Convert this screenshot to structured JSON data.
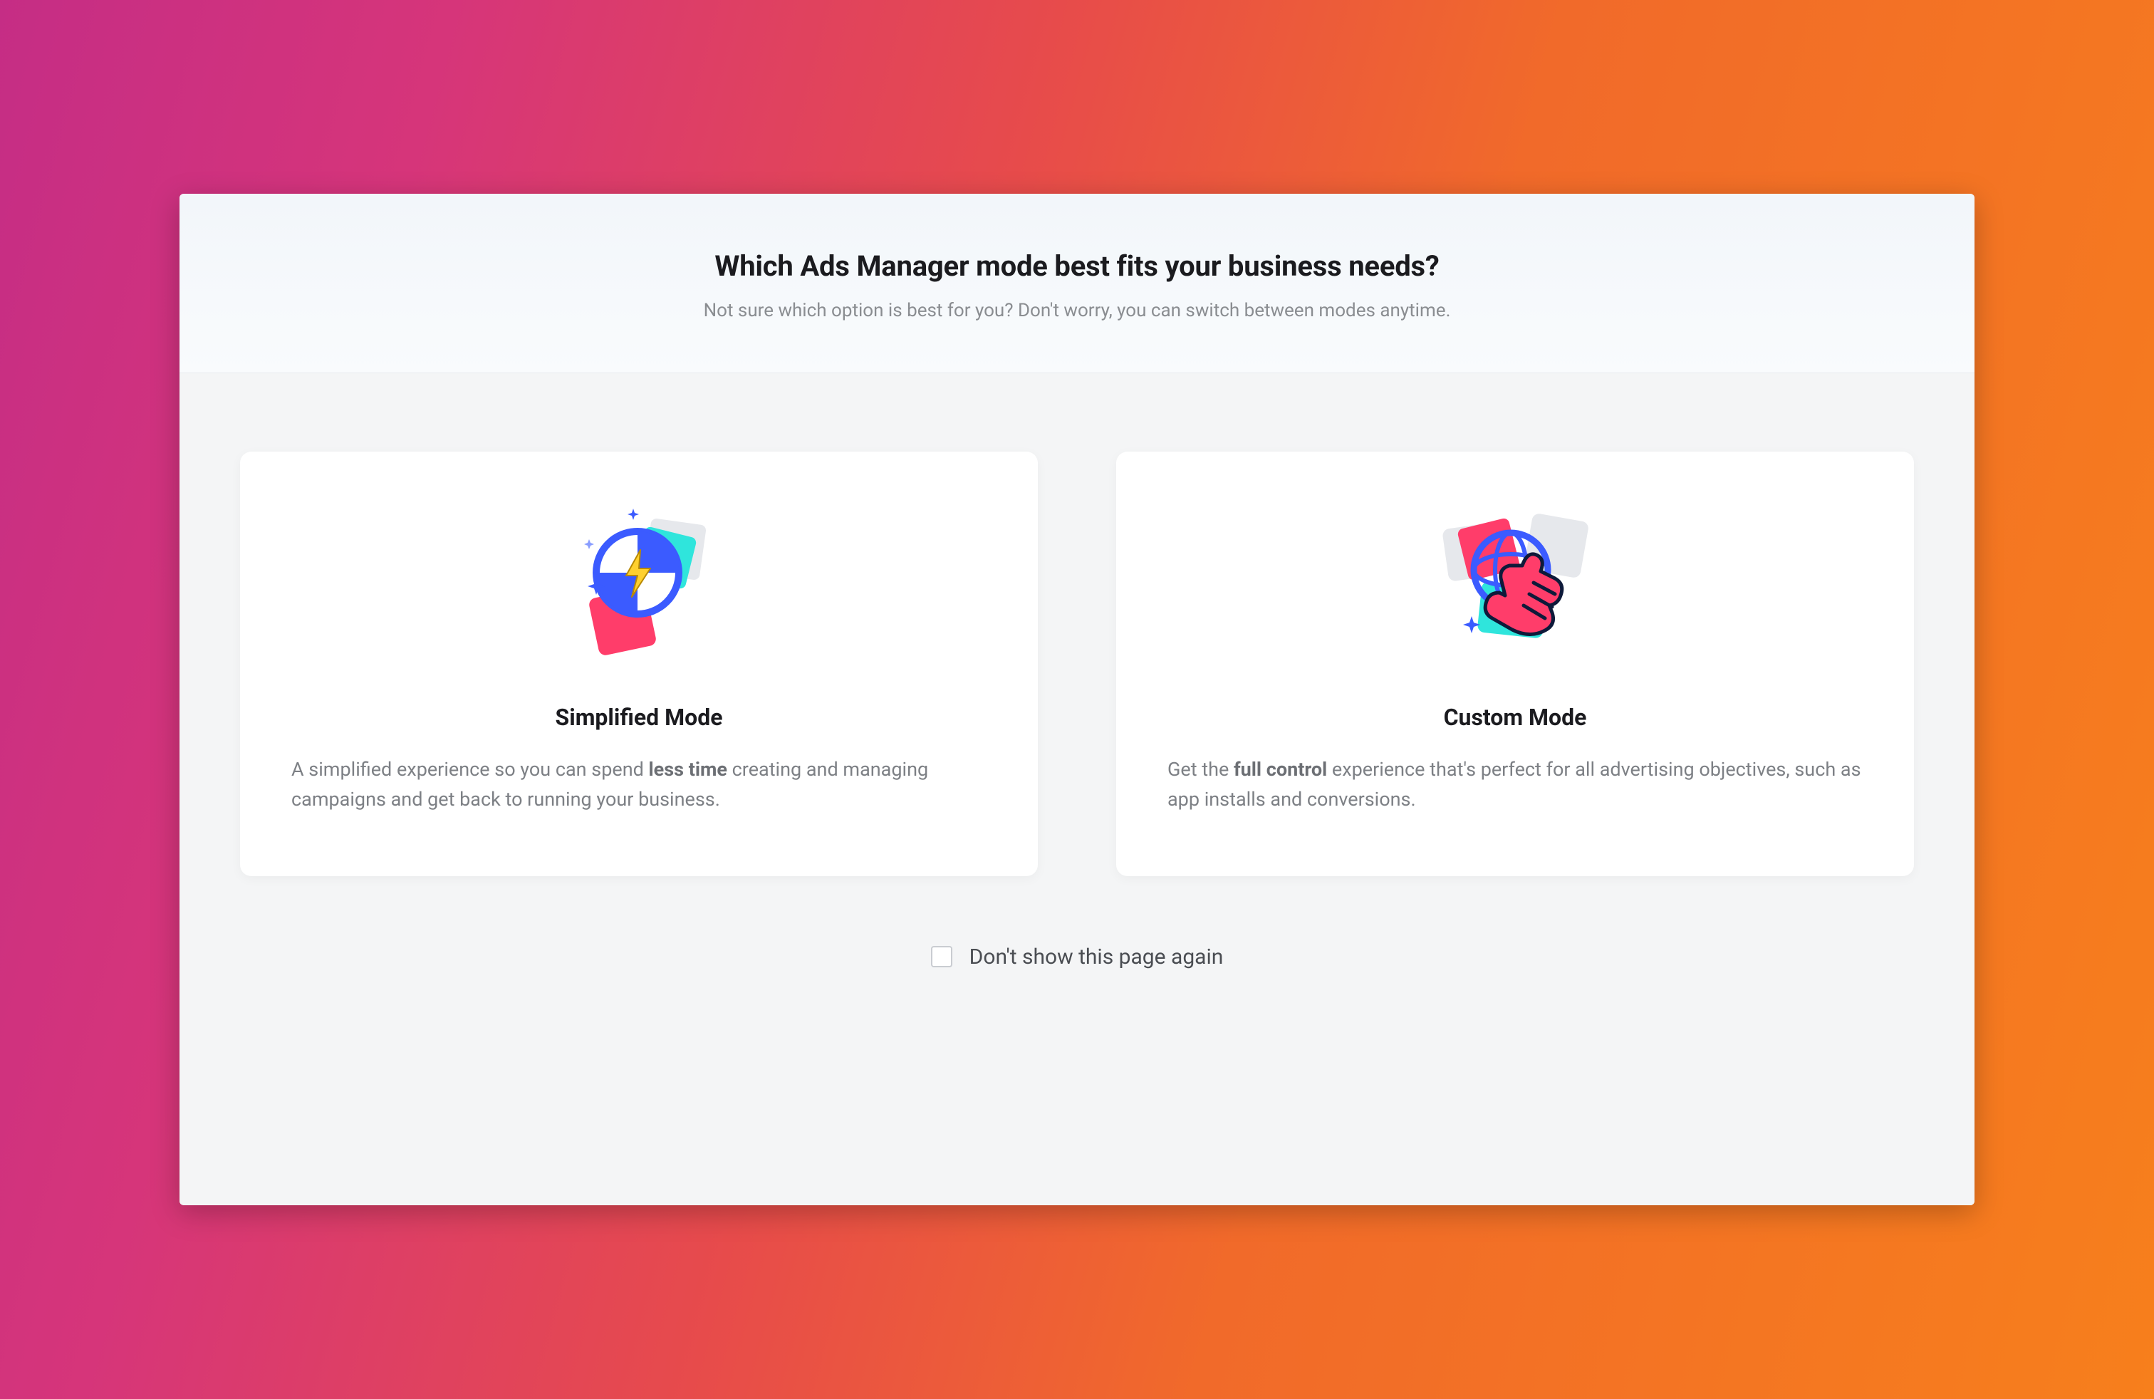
{
  "header": {
    "title": "Which Ads Manager mode best fits your business needs?",
    "subtitle": "Not sure which option is best for you? Don't worry, you can switch between modes anytime."
  },
  "cards": {
    "simplified": {
      "title": "Simplified Mode",
      "desc_before": "A simplified experience so you can spend ",
      "desc_bold": "less time",
      "desc_after": " creating and managing campaigns and get back to running your business."
    },
    "custom": {
      "title": "Custom Mode",
      "desc_before": "Get the ",
      "desc_bold": "full control",
      "desc_after": " experience that's perfect for all advertising objectives, such as app installs and conversions."
    }
  },
  "dont_show_label": "Don't show this page again",
  "colors": {
    "accent_blue": "#3b5bff",
    "accent_pink": "#ff3d6a",
    "accent_teal": "#2fe5dc",
    "accent_yellow": "#ffd02e"
  }
}
